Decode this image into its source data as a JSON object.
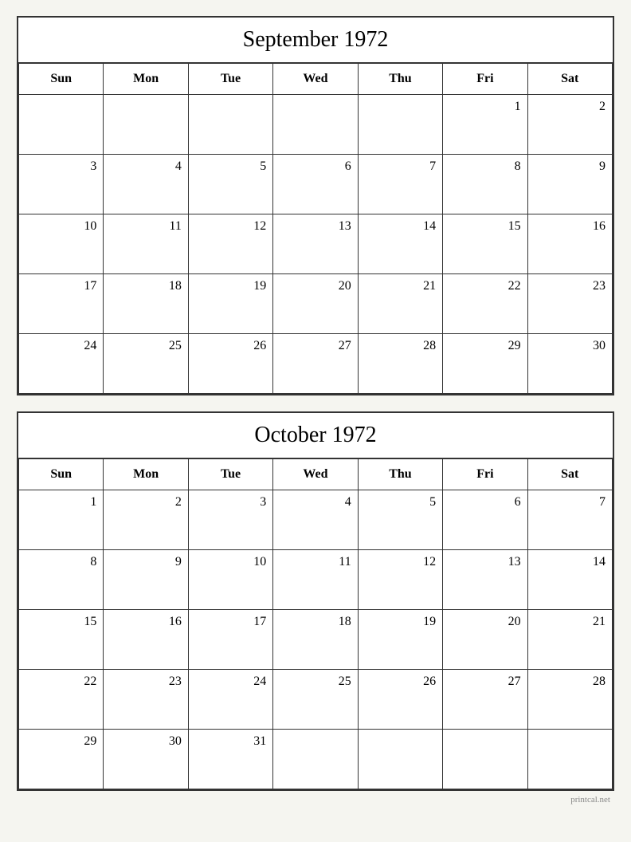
{
  "september": {
    "title": "September 1972",
    "headers": [
      "Sun",
      "Mon",
      "Tue",
      "Wed",
      "Thu",
      "Fri",
      "Sat"
    ],
    "weeks": [
      [
        "",
        "",
        "",
        "",
        "",
        "1",
        "2"
      ],
      [
        "3",
        "4",
        "5",
        "6",
        "7",
        "8",
        "9"
      ],
      [
        "10",
        "11",
        "12",
        "13",
        "14",
        "15",
        "16"
      ],
      [
        "17",
        "18",
        "19",
        "20",
        "21",
        "22",
        "23"
      ],
      [
        "24",
        "25",
        "26",
        "27",
        "28",
        "29",
        "30"
      ]
    ]
  },
  "october": {
    "title": "October 1972",
    "headers": [
      "Sun",
      "Mon",
      "Tue",
      "Wed",
      "Thu",
      "Fri",
      "Sat"
    ],
    "weeks": [
      [
        "1",
        "2",
        "3",
        "4",
        "5",
        "6",
        "7"
      ],
      [
        "8",
        "9",
        "10",
        "11",
        "12",
        "13",
        "14"
      ],
      [
        "15",
        "16",
        "17",
        "18",
        "19",
        "20",
        "21"
      ],
      [
        "22",
        "23",
        "24",
        "25",
        "26",
        "27",
        "28"
      ],
      [
        "29",
        "30",
        "31",
        "",
        "",
        "",
        ""
      ]
    ]
  },
  "watermark": "printcal.net"
}
